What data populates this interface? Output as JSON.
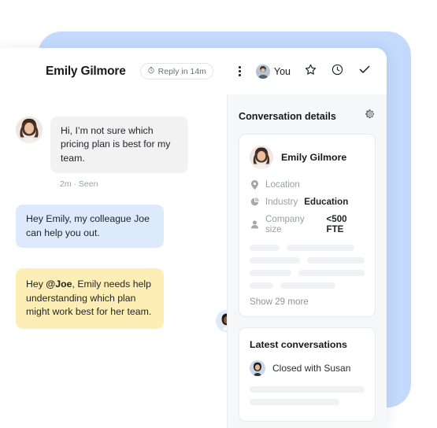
{
  "window": {
    "backdrop_color": "#c3dafc",
    "surface_color": "#ffffff"
  },
  "header": {
    "title": "Emily Gilmore",
    "reply_badge": {
      "icon": "stopwatch-icon",
      "label": "Reply in 14m"
    },
    "actions": {
      "menu_icon": "kebab-menu-icon",
      "assignee_label": "You",
      "assignee_avatar": "avatar-you",
      "star_icon": "star-icon",
      "snooze_icon": "clock-icon",
      "close_icon": "check-icon"
    }
  },
  "conversation": {
    "messages": [
      {
        "id": "m1",
        "direction": "in",
        "avatar": "avatar-emily",
        "text": "Hi, I’m not sure which pricing plan is best for my team.",
        "meta": "2m · Seen"
      },
      {
        "id": "m2",
        "direction": "out",
        "text": "Hey Emily, my colleague Joe can help you out."
      },
      {
        "id": "m3",
        "direction": "note",
        "text_prefix": "Hey ",
        "mention": "@Joe",
        "text_suffix": ", Emily needs help understanding which plan might work best for her team.",
        "avatar": "avatar-author"
      }
    ]
  },
  "details": {
    "title": "Conversation details",
    "settings_icon": "gear-icon",
    "person": {
      "name": "Emily Gilmore",
      "avatar": "avatar-emily"
    },
    "attributes": [
      {
        "icon": "location-pin-icon",
        "key": "Location",
        "value": ""
      },
      {
        "icon": "pie-chart-icon",
        "key": "Industry",
        "value": "Education"
      },
      {
        "icon": "person-icon",
        "key": "Company size",
        "value": "<500 FTE"
      }
    ],
    "placeholder_rows": [
      [
        38,
        86
      ],
      [
        68,
        78
      ],
      [
        58,
        92
      ],
      [
        30,
        70
      ]
    ],
    "show_more": "Show 29 more"
  },
  "latest_conversations": {
    "title": "Latest conversations",
    "items": [
      {
        "avatar": "avatar-susan",
        "text": "Closed with Susan"
      }
    ],
    "placeholder_rows": [
      100,
      78
    ]
  }
}
